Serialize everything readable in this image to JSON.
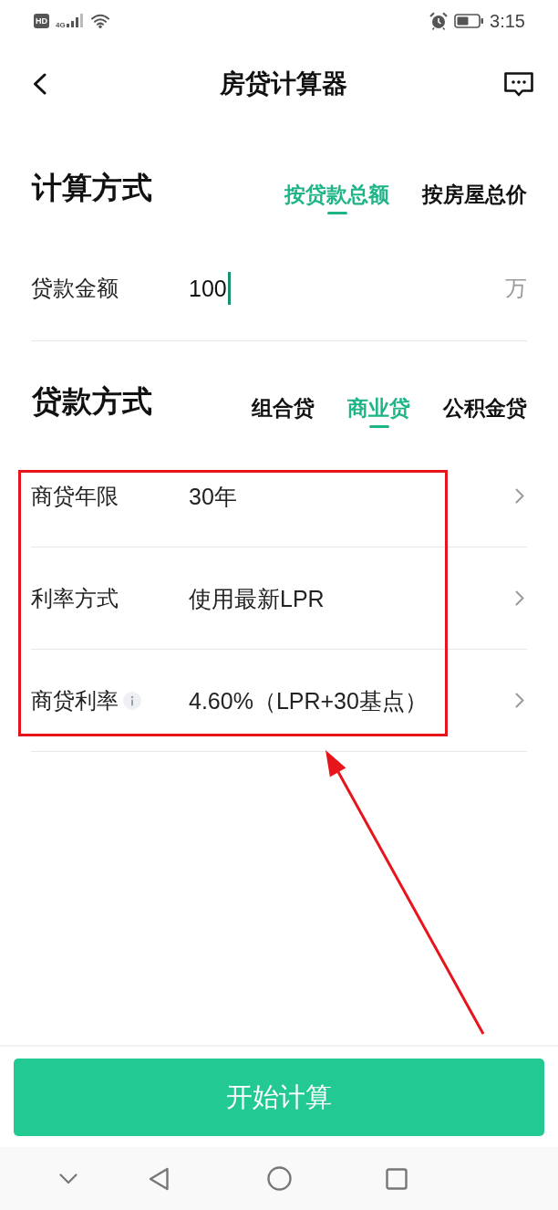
{
  "status_bar": {
    "hd_label": "HD",
    "network_label": "4G",
    "time": "3:15"
  },
  "header": {
    "title": "房贷计算器"
  },
  "calc_method": {
    "title": "计算方式",
    "tabs": [
      {
        "label": "按贷款总额",
        "selected": true
      },
      {
        "label": "按房屋总价",
        "selected": false
      }
    ]
  },
  "loan_amount": {
    "label": "贷款金额",
    "value": "100",
    "focused": true,
    "unit": "万"
  },
  "loan_type": {
    "title": "贷款方式",
    "tabs": [
      {
        "label": "组合贷",
        "selected": false
      },
      {
        "label": "商业贷",
        "selected": true
      },
      {
        "label": "公积金贷",
        "selected": false
      }
    ]
  },
  "loan_settings": [
    {
      "label": "商贷年限",
      "value": "30年",
      "info": false
    },
    {
      "label": "利率方式",
      "value": "使用最新LPR",
      "info": false
    },
    {
      "label": "商贷利率",
      "value": "4.60%（LPR+30基点）",
      "info": true
    }
  ],
  "submit_button": {
    "label": "开始计算"
  }
}
